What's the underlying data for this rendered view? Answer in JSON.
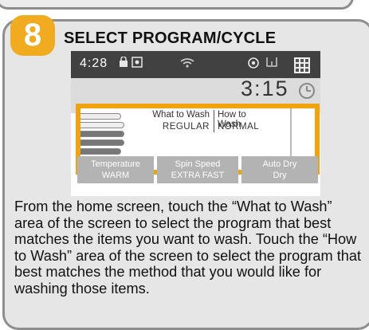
{
  "step": {
    "number": "8",
    "title": "SELECT PROGRAM/CYCLE"
  },
  "status_bar": {
    "time": "4:28"
  },
  "display": {
    "cycle_time": "3:15"
  },
  "selection": {
    "what_to_wash_label": "What to Wash",
    "what_to_wash_value": "REGULAR",
    "how_to_wash_label": "How to Wash",
    "how_to_wash_value": "NORMAL"
  },
  "options": [
    {
      "label": "Temperature",
      "value": "WARM"
    },
    {
      "label": "Spin Speed",
      "value": "EXTRA FAST"
    },
    {
      "label": "Auto Dry",
      "value": "Dry"
    }
  ],
  "instructions": "From the home screen, touch the “What to Wash” area of the screen to select the program that best matches the items you want to wash. Touch the “How to Wash” area of the screen to select the program that best matches the method that you would like for washing those items.",
  "colors": {
    "accent": "#f0a20f",
    "statusbar": "#414141",
    "option_button": "#b3b3b3"
  },
  "icons": [
    "lock-icon",
    "settings-icon",
    "wifi-icon",
    "power-icon",
    "door-icon",
    "menu-grid-icon",
    "delay-clock-icon",
    "load-level-icon"
  ]
}
